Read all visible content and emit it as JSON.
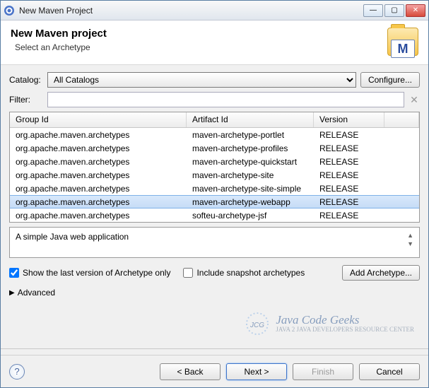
{
  "window": {
    "title": "New Maven Project"
  },
  "header": {
    "title": "New Maven project",
    "subtitle": "Select an Archetype",
    "icon_letter": "M"
  },
  "catalog": {
    "label": "Catalog:",
    "selected": "All Catalogs",
    "configure_btn": "Configure..."
  },
  "filter": {
    "label": "Filter:",
    "value": ""
  },
  "table": {
    "headers": {
      "group": "Group Id",
      "artifact": "Artifact Id",
      "version": "Version"
    },
    "rows": [
      {
        "group": "org.apache.maven.archetypes",
        "artifact": "maven-archetype-portlet",
        "version": "RELEASE"
      },
      {
        "group": "org.apache.maven.archetypes",
        "artifact": "maven-archetype-profiles",
        "version": "RELEASE"
      },
      {
        "group": "org.apache.maven.archetypes",
        "artifact": "maven-archetype-quickstart",
        "version": "RELEASE"
      },
      {
        "group": "org.apache.maven.archetypes",
        "artifact": "maven-archetype-site",
        "version": "RELEASE"
      },
      {
        "group": "org.apache.maven.archetypes",
        "artifact": "maven-archetype-site-simple",
        "version": "RELEASE"
      },
      {
        "group": "org.apache.maven.archetypes",
        "artifact": "maven-archetype-webapp",
        "version": "RELEASE"
      },
      {
        "group": "org.apache.maven.archetypes",
        "artifact": "softeu-archetype-jsf",
        "version": "RELEASE"
      }
    ],
    "selected_index": 5
  },
  "description": "A simple Java web application",
  "options": {
    "show_last_label": "Show the last version of Archetype only",
    "show_last_checked": true,
    "include_snapshot_label": "Include snapshot archetypes",
    "include_snapshot_checked": false,
    "add_btn": "Add Archetype..."
  },
  "advanced_label": "Advanced",
  "watermark": {
    "main": "Java Code Geeks",
    "sub": "JAVA 2 JAVA DEVELOPERS RESOURCE CENTER"
  },
  "footer": {
    "back": "< Back",
    "next": "Next >",
    "finish": "Finish",
    "cancel": "Cancel"
  }
}
